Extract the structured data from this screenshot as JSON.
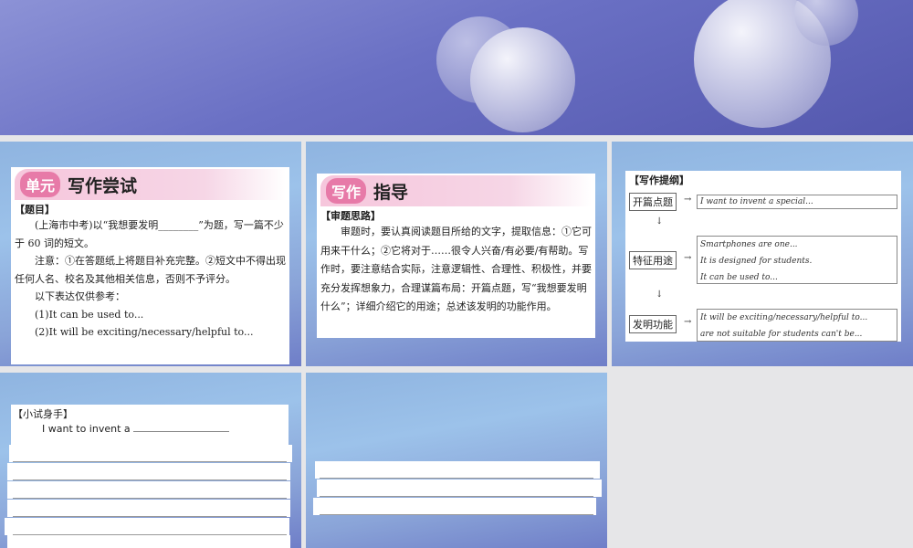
{
  "slide1": {
    "tag": "单元",
    "title": "写作尝试",
    "section": "【题目】",
    "para1": "(上海市中考)以“我想要发明________”为题，写一篇不少于 60 词的短文。",
    "para2": "注意：①在答题纸上将题目补充完整。②短文中不得出现任何人名、校名及其他相关信息，否则不予评分。",
    "para3": "以下表达仅供参考：",
    "ref1": "(1)It can be used to...",
    "ref2": "(2)It will be exciting/necessary/helpful to..."
  },
  "slide2": {
    "tag": "写作",
    "title": "指导",
    "section": "【审题思路】",
    "para": "审题时，要认真阅读题目所给的文字，提取信息：①它可用来干什么；②它将对于……很令人兴奋/有必要/有帮助。写作时，要注意结合实际，注意逻辑性、合理性、积极性，并要充分发挥想象力，合理谋篇布局：开篇点题，写“我想要发明什么”；详细介绍它的用途；总述该发明的功能作用。"
  },
  "slide3": {
    "section": "【写作提纲】",
    "rows": [
      {
        "label": "开篇点题",
        "lines": [
          "I want to invent a special..."
        ]
      },
      {
        "label": "特征用途",
        "lines": [
          "Smartphones are one...",
          "It is designed for students.",
          "It can be used to..."
        ]
      },
      {
        "label": "发明功能",
        "lines": [
          "It will be exciting/necessary/helpful to...",
          "are not suitable for students can't be..."
        ]
      }
    ]
  },
  "slide4": {
    "section": "【小试身手】",
    "prompt": "I want to invent a"
  }
}
